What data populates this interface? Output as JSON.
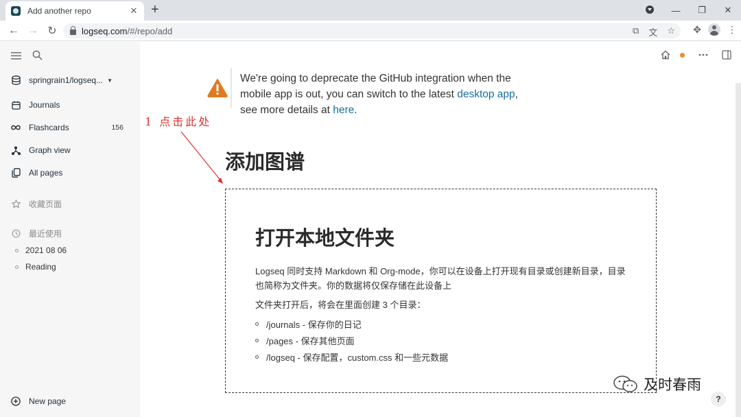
{
  "browser": {
    "tab_title": "Add another repo",
    "tab_close": "✕",
    "new_tab": "+",
    "url_host": "logseq.com",
    "url_path": "/#/repo/add",
    "win_min": "—",
    "win_max": "❐",
    "win_close": "✕"
  },
  "sidebar": {
    "repo": "springrain1/logseq...",
    "journals": "Journals",
    "flashcards": "Flashcards",
    "flashcards_count": "156",
    "graph_view": "Graph view",
    "all_pages": "All pages",
    "favorites": "收藏页面",
    "recent": "最近使用",
    "recent_items": [
      "2021 08 06",
      "Reading"
    ],
    "new_page": "New page"
  },
  "notice": {
    "text_before": "We're going to deprecate the GitHub integration when the mobile app is out, you can switch to the latest ",
    "link1": "desktop app",
    "text_mid": ", see more details at ",
    "link2": "here",
    "text_after": "."
  },
  "annotation": "1 点击此处",
  "page_title": "添加图谱",
  "dropzone": {
    "title": "打开本地文件夹",
    "description": "Logseq 同时支持 Markdown 和 Org-mode，你可以在设备上打开现有目录或创建新目录，目录也简称为文件夹。你的数据将仅保存储在此设备上",
    "subtitle": "文件夹打开后，将会在里面创建 3 个目录：",
    "items": [
      "/journals - 保存你的日记",
      "/pages - 保存其他页面",
      "/logseq - 保存配置，custom.css 和一些元数据"
    ]
  },
  "watermark": "及时春雨",
  "help": "?",
  "colors": {
    "annotation": "#e0302e",
    "link": "#1a6fa0",
    "warning": "#e07b1f",
    "sidebar_bg": "#f6f6f6"
  }
}
